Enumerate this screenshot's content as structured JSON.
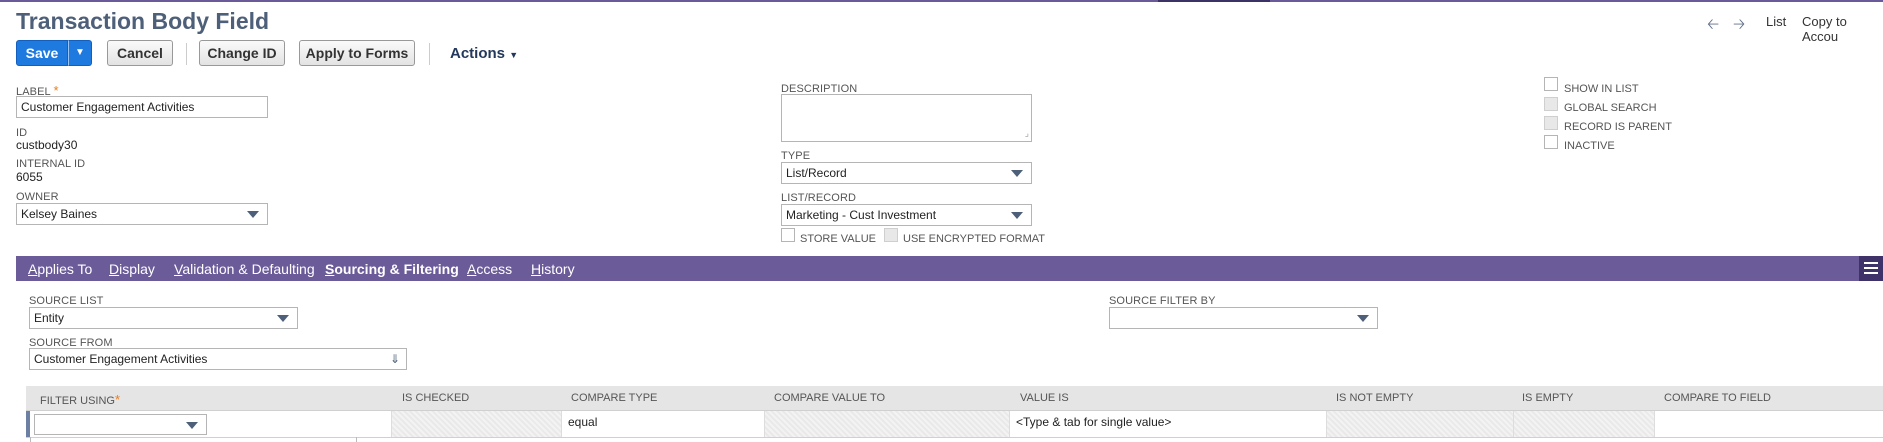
{
  "header": {
    "title": "Transaction Body Field",
    "nav": {
      "list_label": "List",
      "copy_label": "Copy to Accou"
    }
  },
  "toolbar": {
    "save_label": "Save",
    "cancel_label": "Cancel",
    "change_id_label": "Change ID",
    "apply_to_forms_label": "Apply to Forms",
    "actions_label": "Actions"
  },
  "main": {
    "label": {
      "caption": "LABEL",
      "value": "Customer Engagement Activities"
    },
    "id": {
      "caption": "ID",
      "value": "custbody30"
    },
    "internal_id": {
      "caption": "INTERNAL ID",
      "value": "6055"
    },
    "owner": {
      "caption": "OWNER",
      "value": "Kelsey Baines"
    },
    "description": {
      "caption": "DESCRIPTION",
      "value": ""
    },
    "type": {
      "caption": "TYPE",
      "value": "List/Record"
    },
    "list_record": {
      "caption": "LIST/RECORD",
      "value": "Marketing - Cust Investment"
    },
    "store_value_label": "STORE VALUE",
    "use_encrypted_label": "USE ENCRYPTED FORMAT",
    "flags": [
      {
        "label": "SHOW IN LIST",
        "checked": false,
        "disabled": false
      },
      {
        "label": "GLOBAL SEARCH",
        "checked": false,
        "disabled": true
      },
      {
        "label": "RECORD IS PARENT",
        "checked": false,
        "disabled": true
      },
      {
        "label": "INACTIVE",
        "checked": false,
        "disabled": false
      }
    ]
  },
  "tabs": [
    {
      "label": "Applies To",
      "active": false
    },
    {
      "label": "Display",
      "active": false
    },
    {
      "label": "Validation & Defaulting",
      "active": false
    },
    {
      "label": "Sourcing & Filtering",
      "active": true
    },
    {
      "label": "Access",
      "active": false
    },
    {
      "label": "History",
      "active": false
    }
  ],
  "sourcing": {
    "source_list": {
      "caption": "SOURCE LIST",
      "value": "Entity"
    },
    "source_from": {
      "caption": "SOURCE FROM",
      "value": "Customer Engagement Activities"
    },
    "source_filter_by": {
      "caption": "SOURCE FILTER BY",
      "value": ""
    }
  },
  "filter_grid": {
    "columns": [
      "FILTER USING",
      "IS CHECKED",
      "COMPARE TYPE",
      "COMPARE VALUE TO",
      "VALUE IS",
      "IS NOT EMPTY",
      "IS EMPTY",
      "COMPARE TO FIELD"
    ],
    "row": {
      "filter_using": "",
      "compare_type": "equal",
      "value_is": "<Type & tab for single value>"
    }
  },
  "colors": {
    "accent": "#1f7ae0",
    "tab_bar": "#6b5b99",
    "title": "#4d5f79",
    "required": "#e67e22"
  }
}
